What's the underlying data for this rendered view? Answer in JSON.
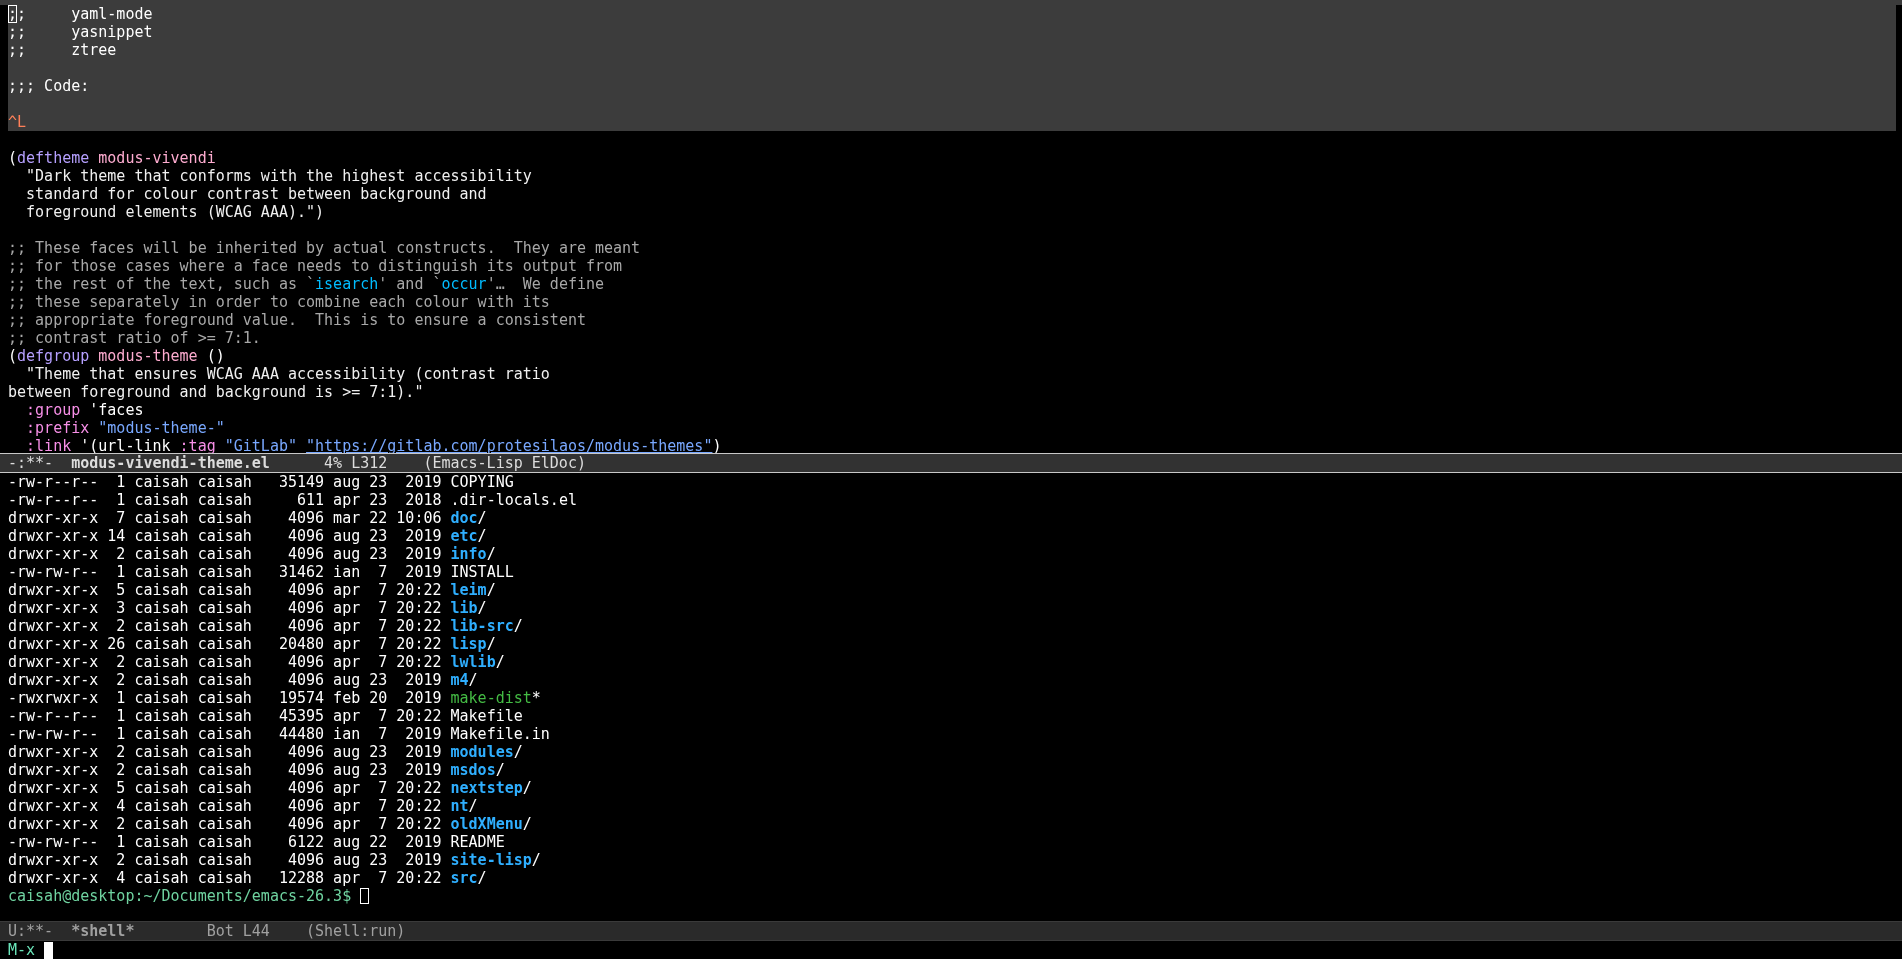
{
  "editor": {
    "lines": [
      {
        "highlighted": true,
        "segments": [
          {
            "kind": "cursor",
            "text": ";"
          },
          {
            "kind": "plain",
            "text": ";     yaml-mode"
          }
        ]
      },
      {
        "highlighted": true,
        "segments": [
          {
            "kind": "plain",
            "text": ";;     yasnippet"
          }
        ]
      },
      {
        "highlighted": true,
        "segments": [
          {
            "kind": "plain",
            "text": ";;     ztree"
          }
        ]
      },
      {
        "highlighted": true
      },
      {
        "highlighted": true,
        "segments": [
          {
            "kind": "plain",
            "text": ";;; Code:"
          }
        ]
      },
      {
        "highlighted": true
      },
      {
        "highlighted": true,
        "segments": [
          {
            "kind": "control",
            "text": "^L"
          }
        ]
      },
      {
        "highlighted": false
      },
      {
        "highlighted": false,
        "segments": [
          {
            "kind": "plain",
            "text": "("
          },
          {
            "kind": "keyword",
            "text": "deftheme"
          },
          {
            "kind": "name",
            "text": " modus-vivendi"
          }
        ]
      },
      {
        "highlighted": false,
        "segments": [
          {
            "kind": "doc",
            "text": "  \"Dark theme that conforms with the highest accessibility"
          }
        ]
      },
      {
        "highlighted": false,
        "segments": [
          {
            "kind": "doc",
            "text": "  standard for colour contrast between background and"
          }
        ]
      },
      {
        "highlighted": false,
        "segments": [
          {
            "kind": "doc",
            "text": "  foreground elements (WCAG AAA).\")"
          }
        ]
      },
      {
        "highlighted": false
      },
      {
        "highlighted": false,
        "segments": [
          {
            "kind": "comment",
            "text": ";; These faces will be inherited by actual constructs.  They are meant"
          }
        ]
      },
      {
        "highlighted": false,
        "segments": [
          {
            "kind": "comment",
            "text": ";; for those cases where a face needs to distinguish its output from"
          }
        ]
      },
      {
        "highlighted": false,
        "segments": [
          {
            "kind": "comment",
            "text": ";; the rest of the text, such as `"
          },
          {
            "kind": "reference",
            "text": "isearch"
          },
          {
            "kind": "comment",
            "text": "' and `"
          },
          {
            "kind": "reference",
            "text": "occur"
          },
          {
            "kind": "comment",
            "text": "'…  We define"
          }
        ]
      },
      {
        "highlighted": false,
        "segments": [
          {
            "kind": "comment",
            "text": ";; these separately in order to combine each colour with its"
          }
        ]
      },
      {
        "highlighted": false,
        "segments": [
          {
            "kind": "comment",
            "text": ";; appropriate foreground value.  This is to ensure a consistent"
          }
        ]
      },
      {
        "highlighted": false,
        "segments": [
          {
            "kind": "comment",
            "text": ";; contrast ratio of >= 7:1."
          }
        ]
      },
      {
        "highlighted": false,
        "segments": [
          {
            "kind": "plain",
            "text": "("
          },
          {
            "kind": "keyword",
            "text": "defgroup"
          },
          {
            "kind": "name",
            "text": " modus-theme"
          },
          {
            "kind": "plain",
            "text": " ()"
          }
        ]
      },
      {
        "highlighted": false,
        "segments": [
          {
            "kind": "doc",
            "text": "  \"Theme that ensures WCAG AAA accessibility (contrast ratio"
          }
        ]
      },
      {
        "highlighted": false,
        "segments": [
          {
            "kind": "doc",
            "text": "between foreground and background is >= 7:1).\""
          }
        ]
      },
      {
        "highlighted": false,
        "segments": [
          {
            "kind": "constant",
            "text": "  :group"
          },
          {
            "kind": "plain",
            "text": " 'faces"
          }
        ]
      },
      {
        "highlighted": false,
        "segments": [
          {
            "kind": "constant",
            "text": "  :prefix"
          },
          {
            "kind": "string",
            "text": " \"modus-theme-\""
          }
        ]
      },
      {
        "highlighted": false,
        "segments": [
          {
            "kind": "constant",
            "text": "  :link"
          },
          {
            "kind": "plain",
            "text": " '(url-link "
          },
          {
            "kind": "constant",
            "text": ":tag"
          },
          {
            "kind": "string",
            "text": " \"GitLab\" "
          },
          {
            "kind": "link",
            "text": "\"https://gitlab.com/protesilaos/modus-themes\""
          },
          {
            "kind": "plain",
            "text": ")"
          }
        ]
      }
    ]
  },
  "editor_mode_line": {
    "active": true,
    "status": "-:**-",
    "buffer": "modus-vivendi-theme.el",
    "position": " 4% L312",
    "modes": "(Emacs-Lisp ElDoc)"
  },
  "shell": {
    "rows": [
      {
        "info": "-rw-r--r--  1 caisah caisah   35149 aug 23  2019 ",
        "name": "COPYING",
        "kind": "file"
      },
      {
        "info": "-rw-r--r--  1 caisah caisah     611 apr 23  2018 ",
        "name": ".dir-locals.el",
        "kind": "file"
      },
      {
        "info": "drwxr-xr-x  7 caisah caisah    4096 mar 22 10:06 ",
        "name": "doc",
        "suffix": "/",
        "kind": "dir"
      },
      {
        "info": "drwxr-xr-x 14 caisah caisah    4096 aug 23  2019 ",
        "name": "etc",
        "suffix": "/",
        "kind": "dir"
      },
      {
        "info": "drwxr-xr-x  2 caisah caisah    4096 aug 23  2019 ",
        "name": "info",
        "suffix": "/",
        "kind": "dir"
      },
      {
        "info": "-rw-rw-r--  1 caisah caisah   31462 ian  7  2019 ",
        "name": "INSTALL",
        "kind": "file"
      },
      {
        "info": "drwxr-xr-x  5 caisah caisah    4096 apr  7 20:22 ",
        "name": "leim",
        "suffix": "/",
        "kind": "dir"
      },
      {
        "info": "drwxr-xr-x  3 caisah caisah    4096 apr  7 20:22 ",
        "name": "lib",
        "suffix": "/",
        "kind": "dir"
      },
      {
        "info": "drwxr-xr-x  2 caisah caisah    4096 apr  7 20:22 ",
        "name": "lib-src",
        "suffix": "/",
        "kind": "dir"
      },
      {
        "info": "drwxr-xr-x 26 caisah caisah   20480 apr  7 20:22 ",
        "name": "lisp",
        "suffix": "/",
        "kind": "dir"
      },
      {
        "info": "drwxr-xr-x  2 caisah caisah    4096 apr  7 20:22 ",
        "name": "lwlib",
        "suffix": "/",
        "kind": "dir"
      },
      {
        "info": "drwxr-xr-x  2 caisah caisah    4096 aug 23  2019 ",
        "name": "m4",
        "suffix": "/",
        "kind": "dir"
      },
      {
        "info": "-rwxrwxr-x  1 caisah caisah   19574 feb 20  2019 ",
        "name": "make-dist",
        "suffix": "*",
        "kind": "exec"
      },
      {
        "info": "-rw-r--r--  1 caisah caisah   45395 apr  7 20:22 ",
        "name": "Makefile",
        "kind": "file"
      },
      {
        "info": "-rw-rw-r--  1 caisah caisah   44480 ian  7  2019 ",
        "name": "Makefile.in",
        "kind": "file"
      },
      {
        "info": "drwxr-xr-x  2 caisah caisah    4096 aug 23  2019 ",
        "name": "modules",
        "suffix": "/",
        "kind": "dir"
      },
      {
        "info": "drwxr-xr-x  2 caisah caisah    4096 aug 23  2019 ",
        "name": "msdos",
        "suffix": "/",
        "kind": "dir"
      },
      {
        "info": "drwxr-xr-x  5 caisah caisah    4096 apr  7 20:22 ",
        "name": "nextstep",
        "suffix": "/",
        "kind": "dir"
      },
      {
        "info": "drwxr-xr-x  4 caisah caisah    4096 apr  7 20:22 ",
        "name": "nt",
        "suffix": "/",
        "kind": "dir"
      },
      {
        "info": "drwxr-xr-x  2 caisah caisah    4096 apr  7 20:22 ",
        "name": "oldXMenu",
        "suffix": "/",
        "kind": "dir"
      },
      {
        "info": "-rw-rw-r--  1 caisah caisah    6122 aug 22  2019 ",
        "name": "README",
        "kind": "file"
      },
      {
        "info": "drwxr-xr-x  2 caisah caisah    4096 aug 23  2019 ",
        "name": "site-lisp",
        "suffix": "/",
        "kind": "dir"
      },
      {
        "info": "drwxr-xr-x  4 caisah caisah   12288 apr  7 20:22 ",
        "name": "src",
        "suffix": "/",
        "kind": "dir"
      }
    ],
    "prompt": "caisah@desktop:~/Documents/emacs-26.3$"
  },
  "shell_mode_line": {
    "active": false,
    "status": "U:**-",
    "buffer": "*shell*",
    "position": "Bot L44",
    "modes": "(Shell:run)"
  },
  "minibuffer": {
    "prompt": "M-x"
  }
}
